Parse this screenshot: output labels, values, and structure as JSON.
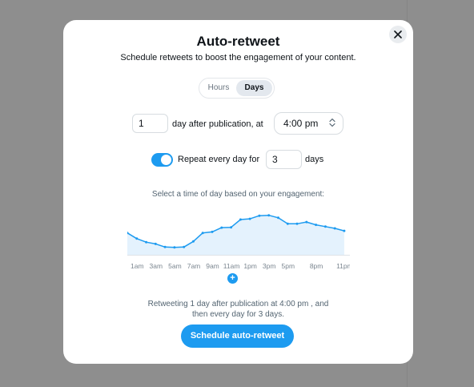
{
  "modal": {
    "title": "Auto-retweet",
    "subtitle": "Schedule retweets to boost the engagement of your content.",
    "close_icon": "close-icon"
  },
  "mode_toggle": {
    "options": [
      "Hours",
      "Days"
    ],
    "selected": "Days"
  },
  "schedule": {
    "delay_value": "1",
    "delay_text": "day after publication, at",
    "time_value": "4:00 pm",
    "time_icon": "chevron-up-down-icon"
  },
  "repeat": {
    "enabled": true,
    "label": "Repeat every day for",
    "count_value": "3",
    "unit": "days"
  },
  "engagement": {
    "caption": "Select a time of day based on your engagement:",
    "add_icon": "plus-icon"
  },
  "summary": {
    "line1": "Retweeting 1 day after publication at 4:00 pm , and",
    "line2": "then every day for 3 days."
  },
  "action": {
    "label": "Schedule auto-retweet"
  },
  "colors": {
    "accent": "#1d9bf0",
    "chart_fill": "#e4f2fd",
    "text": "#0f1419",
    "muted": "#536471"
  },
  "chart_data": {
    "type": "area",
    "x_tick_labels": [
      "1am",
      "3am",
      "5am",
      "7am",
      "9am",
      "11am",
      "1pm",
      "3pm",
      "5pm",
      "8pm",
      "11pm"
    ],
    "x_tick_hours": [
      1,
      3,
      5,
      7,
      9,
      11,
      13,
      15,
      17,
      20,
      23
    ],
    "x": [
      0,
      1,
      2,
      3,
      4,
      5,
      6,
      7,
      8,
      9,
      10,
      11,
      12,
      13,
      14,
      15,
      16,
      17,
      18,
      19,
      20,
      21,
      22,
      23
    ],
    "values": [
      0.62,
      0.46,
      0.36,
      0.31,
      0.22,
      0.21,
      0.22,
      0.38,
      0.62,
      0.65,
      0.77,
      0.78,
      1.0,
      1.02,
      1.11,
      1.12,
      1.05,
      0.88,
      0.88,
      0.93,
      0.85,
      0.8,
      0.75,
      0.68
    ],
    "ylim": [
      0,
      1.25
    ],
    "xlim": [
      0,
      23.6
    ],
    "grid": false,
    "legend": "none"
  }
}
